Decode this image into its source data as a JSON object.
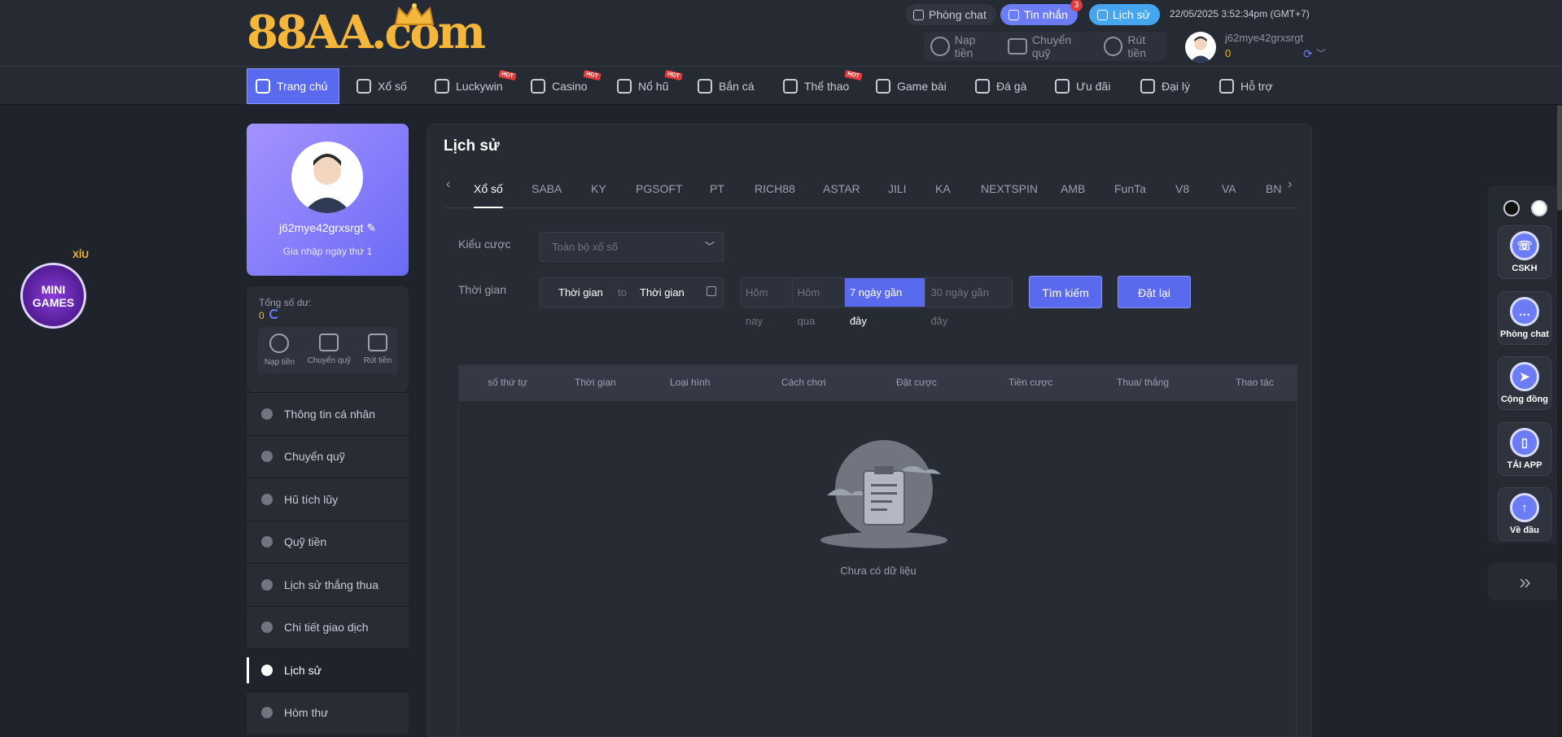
{
  "brand": {
    "logo_text": "88AA.com",
    "accent": "#5a6aee",
    "gold": "#f4b73b"
  },
  "header": {
    "chat_label": "Phòng chat",
    "messages_label": "Tin nhắn",
    "messages_count": "3",
    "history_label": "Lịch sử",
    "datetime": "22/05/2025 3:52:34pm",
    "timezone": "(GMT+7)",
    "deposit_label": "Nạp tiền",
    "transfer_label": "Chuyển quỹ",
    "withdraw_label": "Rút tiền",
    "username": "j62mye42grxsrgt",
    "balance": "0"
  },
  "nav": {
    "items": [
      {
        "label": "Trang chủ",
        "icon": "home-icon",
        "hot": false
      },
      {
        "label": "Xổ số",
        "icon": "lottery-icon",
        "hot": false
      },
      {
        "label": "Luckywin",
        "icon": "luckywin-icon",
        "hot": true
      },
      {
        "label": "Casino",
        "icon": "casino-icon",
        "hot": true
      },
      {
        "label": "Nổ hũ",
        "icon": "slots-icon",
        "hot": true
      },
      {
        "label": "Bắn cá",
        "icon": "fish-icon",
        "hot": false
      },
      {
        "label": "Thể thao",
        "icon": "sports-icon",
        "hot": true
      },
      {
        "label": "Game bài",
        "icon": "cards-icon",
        "hot": false
      },
      {
        "label": "Đá gà",
        "icon": "rooster-icon",
        "hot": false
      },
      {
        "label": "Ưu đãi",
        "icon": "gift-icon",
        "hot": false
      },
      {
        "label": "Đại lý",
        "icon": "agent-icon",
        "hot": false
      },
      {
        "label": "Hỗ trợ",
        "icon": "support-icon",
        "hot": false
      }
    ],
    "hot_label": "HOT"
  },
  "profile": {
    "username": "j62mye42grxsrgt",
    "joined": "Gia nhập ngày thứ 1",
    "balance_label": "Tổng số dư:",
    "balance": "0",
    "deposit_label": "Nạp tiền",
    "transfer_label": "Chuyển quỹ",
    "withdraw_label": "Rút tiền"
  },
  "menu": {
    "items": [
      {
        "label": "Thông tin cá nhân",
        "active": false
      },
      {
        "label": "Chuyển quỹ",
        "active": false
      },
      {
        "label": "Hũ tích lũy",
        "active": false
      },
      {
        "label": "Quỹ tiền",
        "active": false
      },
      {
        "label": "Lịch sử thắng thua",
        "active": false
      },
      {
        "label": "Chi tiết giao dịch",
        "active": false
      },
      {
        "label": "Lịch sử",
        "active": true
      },
      {
        "label": "Hòm thư",
        "active": false
      }
    ]
  },
  "minigames": {
    "label_top": "MINI",
    "label_bottom": "GAMES",
    "tag": "XỈU"
  },
  "main": {
    "title": "Lịch sử",
    "tabs": [
      "Xổ số",
      "SABA",
      "KY",
      "PGSOFT",
      "PT",
      "RICH88",
      "ASTAR",
      "JILI",
      "KA",
      "NEXTSPIN",
      "AMB",
      "FunTa",
      "V8",
      "VA",
      "BN"
    ],
    "active_tab": 0,
    "filter": {
      "bet_type_label": "Kiểu cược",
      "bet_type_value": "Toàn bộ xổ số",
      "time_label": "Thời gian",
      "from_placeholder": "Thời gian",
      "to_label": "to",
      "to_placeholder": "Thời gian",
      "quick_dates": [
        "Hôm nay",
        "Hôm qua",
        "7 ngày gần đây",
        "30 ngày gần đây"
      ],
      "quick_active": 2,
      "search_label": "Tìm kiếm",
      "reset_label": "Đặt lại"
    },
    "table": {
      "columns": [
        "số thứ tự",
        "Thời gian",
        "Loại hình",
        "Cách chơi",
        "Đặt cược",
        "Tiền cược",
        "Thua/ thắng",
        "Thao tác"
      ],
      "empty_text": "Chưa có dữ liệu"
    }
  },
  "right_bar": {
    "items": [
      {
        "label": "CSKH",
        "icon": "headset-icon"
      },
      {
        "label": "Phòng chat",
        "icon": "chat-icon"
      },
      {
        "label": "Cộng đồng",
        "icon": "send-icon"
      },
      {
        "label": "TẢI APP",
        "icon": "phone-icon"
      },
      {
        "label": "Về đầu",
        "icon": "arrow-up-icon"
      }
    ]
  }
}
